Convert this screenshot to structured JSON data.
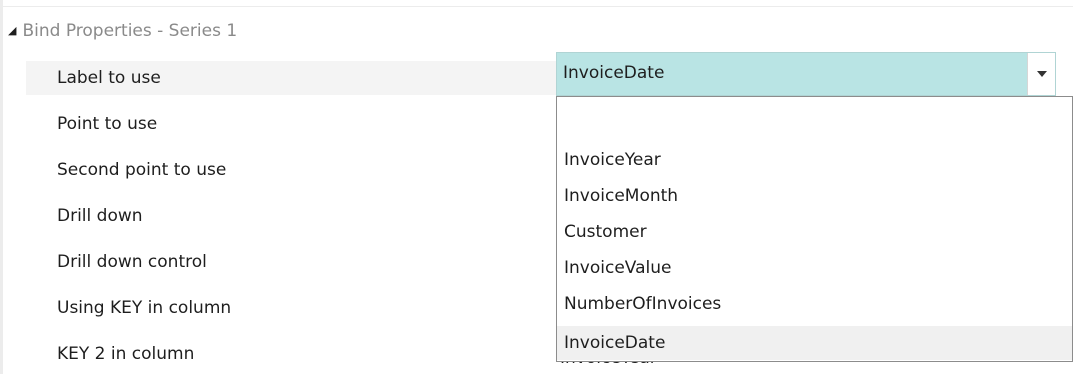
{
  "section": {
    "title": "Bind Properties - Series 1",
    "expand_glyph": "triangle-collapse-icon"
  },
  "properties": [
    {
      "label": "Label to use"
    },
    {
      "label": "Point to use"
    },
    {
      "label": "Second point to use"
    },
    {
      "label": "Drill down"
    },
    {
      "label": "Drill down control"
    },
    {
      "label": "Using KEY in column"
    },
    {
      "label": "KEY 2 in column"
    }
  ],
  "selected_field": {
    "value": "InvoiceDate",
    "dropdown_icon": "chevron-down-icon"
  },
  "partially_hidden_value": "InvoiceYear",
  "dropdown_options": [
    "",
    "InvoiceYear",
    "InvoiceMonth",
    "Customer",
    "InvoiceValue",
    "NumberOfInvoices",
    "InvoiceDate"
  ],
  "colors": {
    "selected_bg": "#b9e4e4",
    "header_text": "#8a8a8a",
    "highlight": "#f0f0f0"
  }
}
